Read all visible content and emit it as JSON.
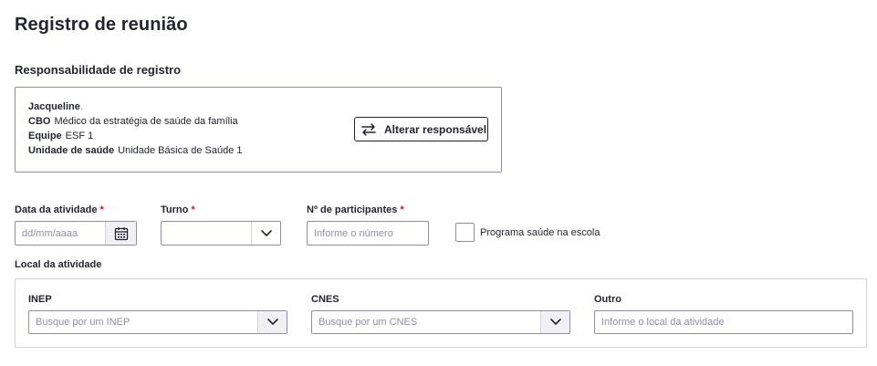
{
  "page": {
    "title": "Registro de reunião"
  },
  "responsabilidade": {
    "section_title": "Responsabilidade de registro",
    "nome": "Jacqueline",
    "cbo_label": "CBO",
    "cbo_value": "Médico da estratégia de saúde da família",
    "equipe_label": "Equipe",
    "equipe_value": "ESF 1",
    "unidade_label": "Unidade de saúde",
    "unidade_value": "Unidade Básica de Saúde 1",
    "alterar_button": "Alterar responsável"
  },
  "form": {
    "data_label": "Data da atividade",
    "data_placeholder": "dd/mm/aaaa",
    "turno_label": "Turno",
    "turno_value": "",
    "participantes_label": "Nº de participantes",
    "participantes_placeholder": "Informe o número",
    "required_mark": "*",
    "programa_label": "Programa saúde na escola",
    "programa_checked": false
  },
  "local": {
    "label": "Local da atividade",
    "inep_label": "INEP",
    "inep_placeholder": "Busque por um INEP",
    "cnes_label": "CNES",
    "cnes_placeholder": "Busque por um CNES",
    "outro_label": "Outro",
    "outro_placeholder": "Informe o local da atividade"
  },
  "icons": {
    "swap": "swap-arrows-icon",
    "calendar": "calendar-icon",
    "chevron": "chevron-down-icon"
  },
  "colors": {
    "text": "#24252e",
    "required": "#d01e1e",
    "border": "#8f8fa2",
    "addon_bg": "#f0f0f5"
  }
}
